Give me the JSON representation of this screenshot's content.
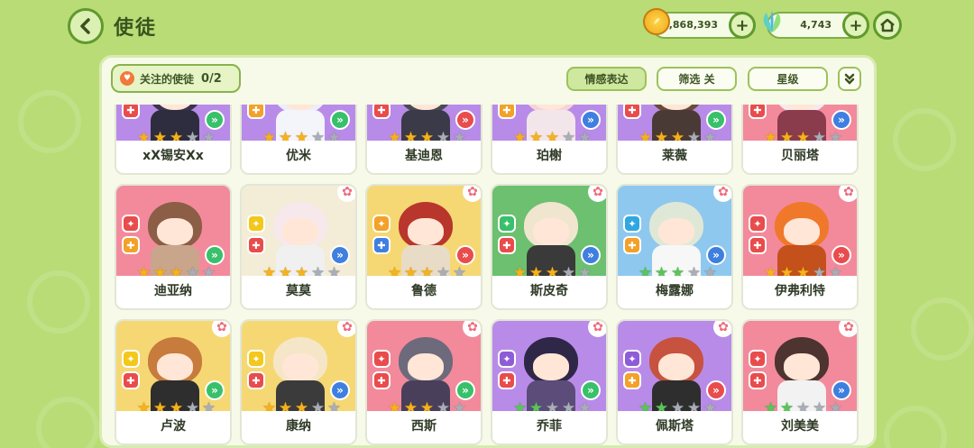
{
  "header": {
    "title": "使徒",
    "coins": "1,868,393",
    "gems": "4,743"
  },
  "toolbar": {
    "focus_label": "关注的使徒",
    "focus_count": "0/2",
    "emotion_label": "情感表达",
    "filter_label": "筛选 关",
    "star_label": "星级"
  },
  "characters": [
    {
      "name": "xX锡安Xx",
      "stars": 3,
      "star_color": "gold",
      "bg": "#b98be8",
      "hair": "#3c3350",
      "outfit": "#2d2d3f",
      "badge_top": "#8e5cd6",
      "badge_bot": "#e84c4c",
      "role": "#38c06a",
      "fav": false
    },
    {
      "name": "优米",
      "stars": 3,
      "star_color": "gold",
      "bg": "#b98be8",
      "hair": "#eeeef8",
      "outfit": "#f4f4fb",
      "badge_top": "#8e5cd6",
      "badge_bot": "#f3a128",
      "role": "#38c06a",
      "fav": false
    },
    {
      "name": "基迪恩",
      "stars": 3,
      "star_color": "gold",
      "bg": "#b98be8",
      "hair": "#4a4a55",
      "outfit": "#3a3a48",
      "badge_top": "#8e5cd6",
      "badge_bot": "#e84c4c",
      "role": "#e84c4c",
      "fav": false
    },
    {
      "name": "珀榭",
      "stars": 3,
      "star_color": "gold",
      "bg": "#b98be8",
      "hair": "#f6d3d9",
      "outfit": "#f3e6ea",
      "badge_top": "#8e5cd6",
      "badge_bot": "#f3a128",
      "role": "#3f7fe0",
      "fav": false
    },
    {
      "name": "莱薇",
      "stars": 3,
      "star_color": "gold",
      "bg": "#b98be8",
      "hair": "#6b4a3c",
      "outfit": "#4a3a35",
      "badge_top": "#8e5cd6",
      "badge_bot": "#e84c4c",
      "role": "#38c06a",
      "fav": false
    },
    {
      "name": "贝丽塔",
      "stars": 3,
      "star_color": "gold",
      "bg": "#f28a9c",
      "hair": "#f5e9ef",
      "outfit": "#8a3b4c",
      "badge_top": "#e84c4c",
      "badge_bot": "#e84c4c",
      "role": "#3f7fe0",
      "fav": false
    },
    {
      "name": "迪亚纳",
      "stars": 3,
      "star_color": "gold",
      "bg": "#f28a9c",
      "hair": "#8b5e45",
      "outfit": "#c9a58c",
      "badge_top": "#e84c4c",
      "badge_bot": "#f3a128",
      "role": "#38c06a",
      "fav": false
    },
    {
      "name": "莫莫",
      "stars": 3,
      "star_color": "gold",
      "bg": "#f3ecd6",
      "hair": "#f7e8ec",
      "outfit": "#f0f0f0",
      "badge_top": "#f3c81c",
      "badge_bot": "#e84c4c",
      "role": "#3f7fe0",
      "fav": true
    },
    {
      "name": "鲁德",
      "stars": 3,
      "star_color": "gold",
      "bg": "#f5d874",
      "hair": "#b9362c",
      "outfit": "#e8dcc6",
      "badge_top": "#f3a128",
      "badge_bot": "#3f7fe0",
      "role": "#e84c4c",
      "fav": true
    },
    {
      "name": "斯皮奇",
      "stars": 3,
      "star_color": "gold",
      "bg": "#6cc070",
      "hair": "#f0e6cf",
      "outfit": "#3a3a3a",
      "badge_top": "#38c06a",
      "badge_bot": "#e84c4c",
      "role": "#3f7fe0",
      "fav": true
    },
    {
      "name": "梅露娜",
      "stars": 3,
      "star_color": "green",
      "bg": "#8ec8ef",
      "hair": "#dfe8d6",
      "outfit": "#f7f7f7",
      "badge_top": "#2fa7e0",
      "badge_bot": "#f3a128",
      "role": "#3f7fe0",
      "fav": true
    },
    {
      "name": "伊弗利特",
      "stars": 3,
      "star_color": "gold",
      "bg": "#f28a9c",
      "hair": "#f0782a",
      "outfit": "#c4501c",
      "badge_top": "#e84c4c",
      "badge_bot": "#e84c4c",
      "role": "#e84c4c",
      "fav": true
    },
    {
      "name": "卢波",
      "stars": 3,
      "star_color": "gold",
      "bg": "#f5d874",
      "hair": "#c77b3c",
      "outfit": "#2e2e2e",
      "badge_top": "#f3c81c",
      "badge_bot": "#e84c4c",
      "role": "#38c06a",
      "fav": true
    },
    {
      "name": "康纳",
      "stars": 3,
      "star_color": "gold",
      "bg": "#f5d874",
      "hair": "#f6e6c8",
      "outfit": "#3b3b3b",
      "badge_top": "#f3c81c",
      "badge_bot": "#e84c4c",
      "role": "#3f7fe0",
      "fav": true
    },
    {
      "name": "西斯",
      "stars": 3,
      "star_color": "gold",
      "bg": "#f28a9c",
      "hair": "#6d6a7c",
      "outfit": "#4a3f5a",
      "badge_top": "#e84c4c",
      "badge_bot": "#e84c4c",
      "role": "#38c06a",
      "fav": true
    },
    {
      "name": "乔菲",
      "stars": 2,
      "star_color": "green",
      "bg": "#b98be8",
      "hair": "#2f2748",
      "outfit": "#5b4c7a",
      "badge_top": "#8e5cd6",
      "badge_bot": "#e84c4c",
      "role": "#38c06a",
      "fav": true
    },
    {
      "name": "佩斯塔",
      "stars": 2,
      "star_color": "green",
      "bg": "#b98be8",
      "hair": "#c7523f",
      "outfit": "#2e2e2e",
      "badge_top": "#8e5cd6",
      "badge_bot": "#f3a128",
      "role": "#e84c4c",
      "fav": true
    },
    {
      "name": "刘美美",
      "stars": 2,
      "star_color": "green",
      "bg": "#f28a9c",
      "hair": "#4d3430",
      "outfit": "#f2f2f2",
      "badge_top": "#e84c4c",
      "badge_bot": "#e84c4c",
      "role": "#3f7fe0",
      "fav": true
    }
  ]
}
